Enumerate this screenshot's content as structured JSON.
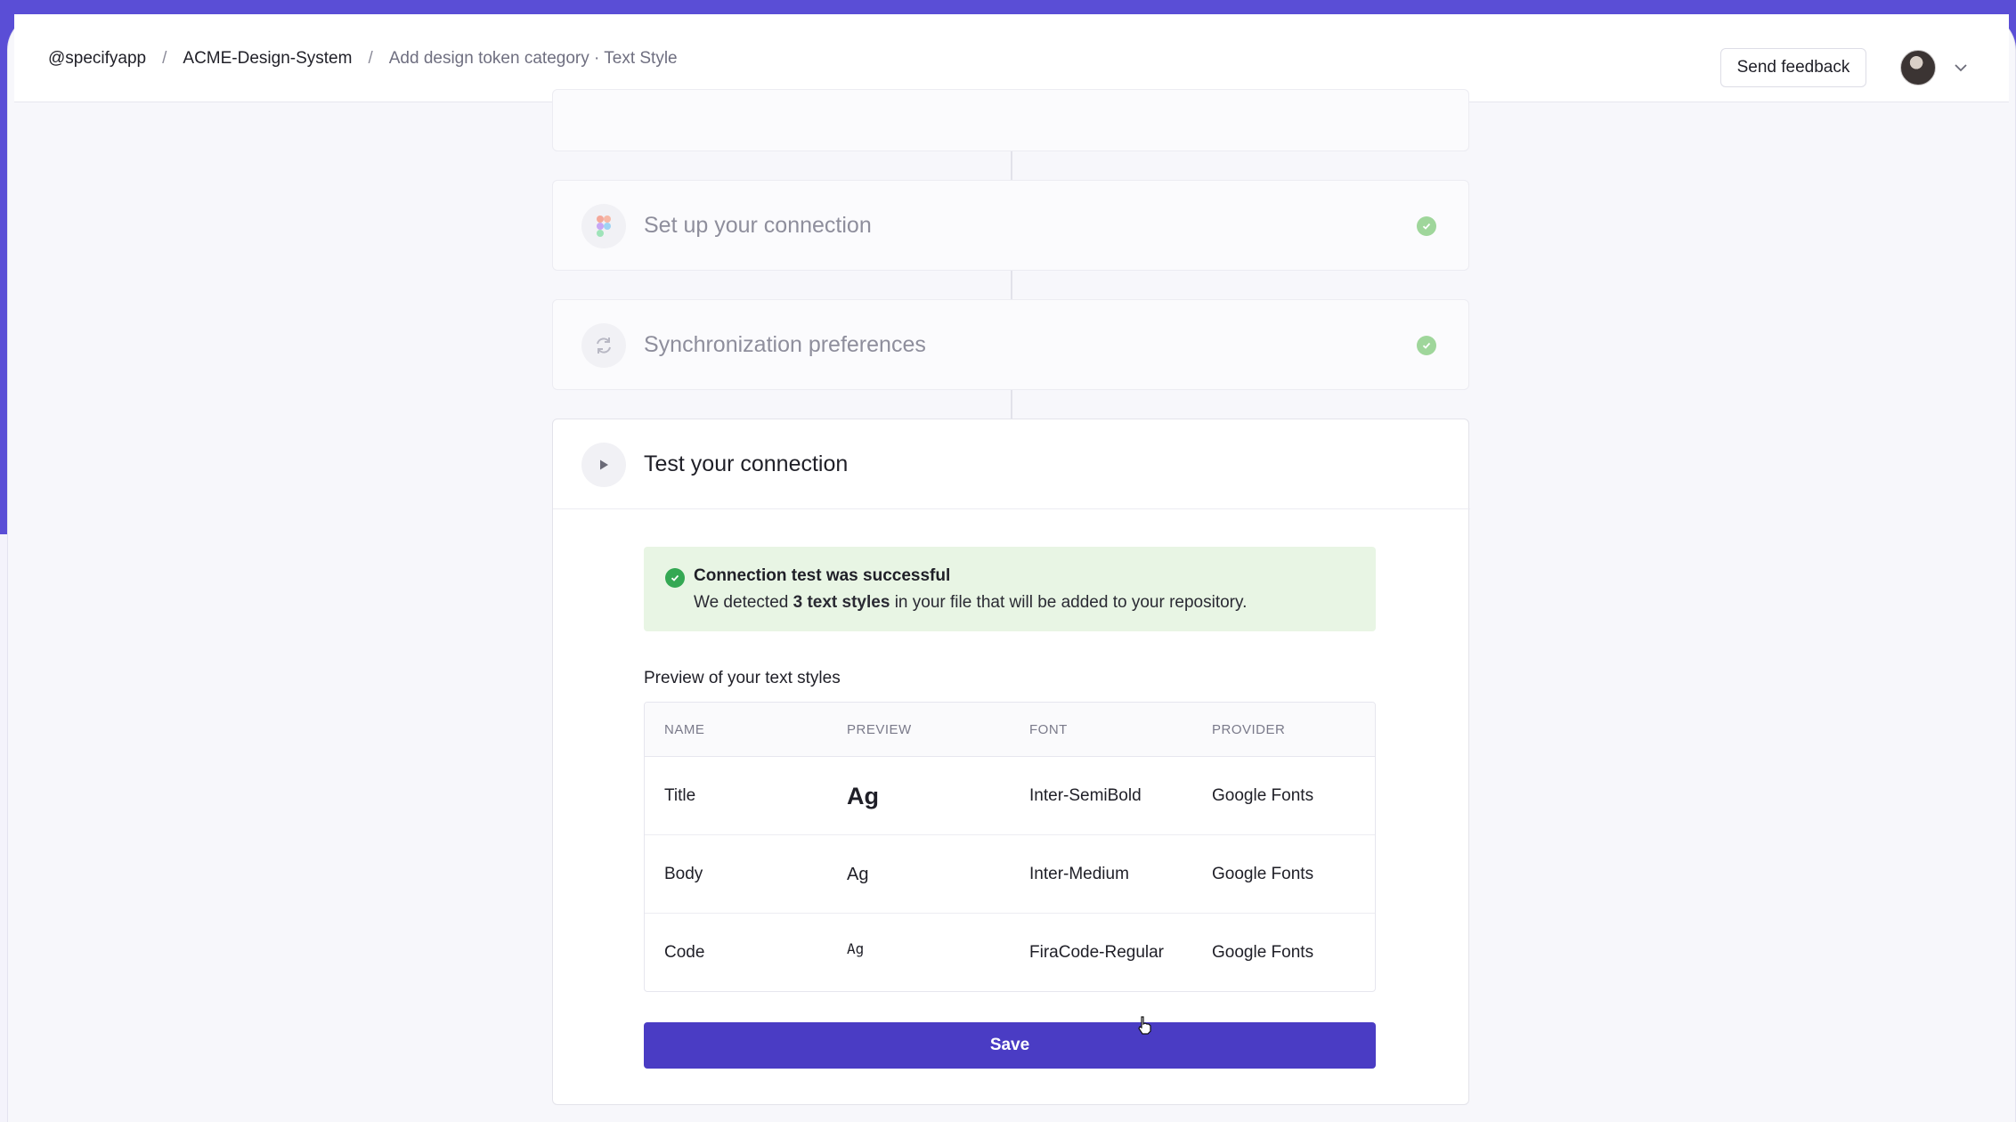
{
  "breadcrumb": {
    "org": "@specifyapp",
    "separator": "/",
    "repo": "ACME-Design-System",
    "page": "Add design token category · Text Style"
  },
  "header": {
    "feedback_label": "Send feedback"
  },
  "steps": [
    {
      "title": "Set up your connection",
      "status": "done",
      "icon": "figma-icon"
    },
    {
      "title": "Synchronization preferences",
      "status": "done",
      "icon": "sync-icon"
    },
    {
      "title": "Test your connection",
      "status": "active",
      "icon": "play-icon"
    }
  ],
  "alert": {
    "title": "Connection test was successful",
    "body_prefix": "We detected",
    "body_bold": "3 text styles",
    "body_suffix": "in your file that will be added to your repository."
  },
  "preview": {
    "label": "Preview of your text styles",
    "columns": [
      "NAME",
      "PREVIEW",
      "FONT",
      "PROVIDER"
    ],
    "rows": [
      {
        "name": "Title",
        "preview": "Ag",
        "font": "Inter-SemiBold",
        "provider": "Google Fonts"
      },
      {
        "name": "Body",
        "preview": "Ag",
        "font": "Inter-Medium",
        "provider": "Google Fonts"
      },
      {
        "name": "Code",
        "preview": "Ag",
        "font": "FiraCode-Regular",
        "provider": "Google Fonts"
      }
    ]
  },
  "actions": {
    "save_label": "Save"
  },
  "colors": {
    "brand": "#5b4fd4",
    "primary_button": "#4a3cc4",
    "success": "#34a853",
    "success_bg": "#e8f5e4"
  }
}
